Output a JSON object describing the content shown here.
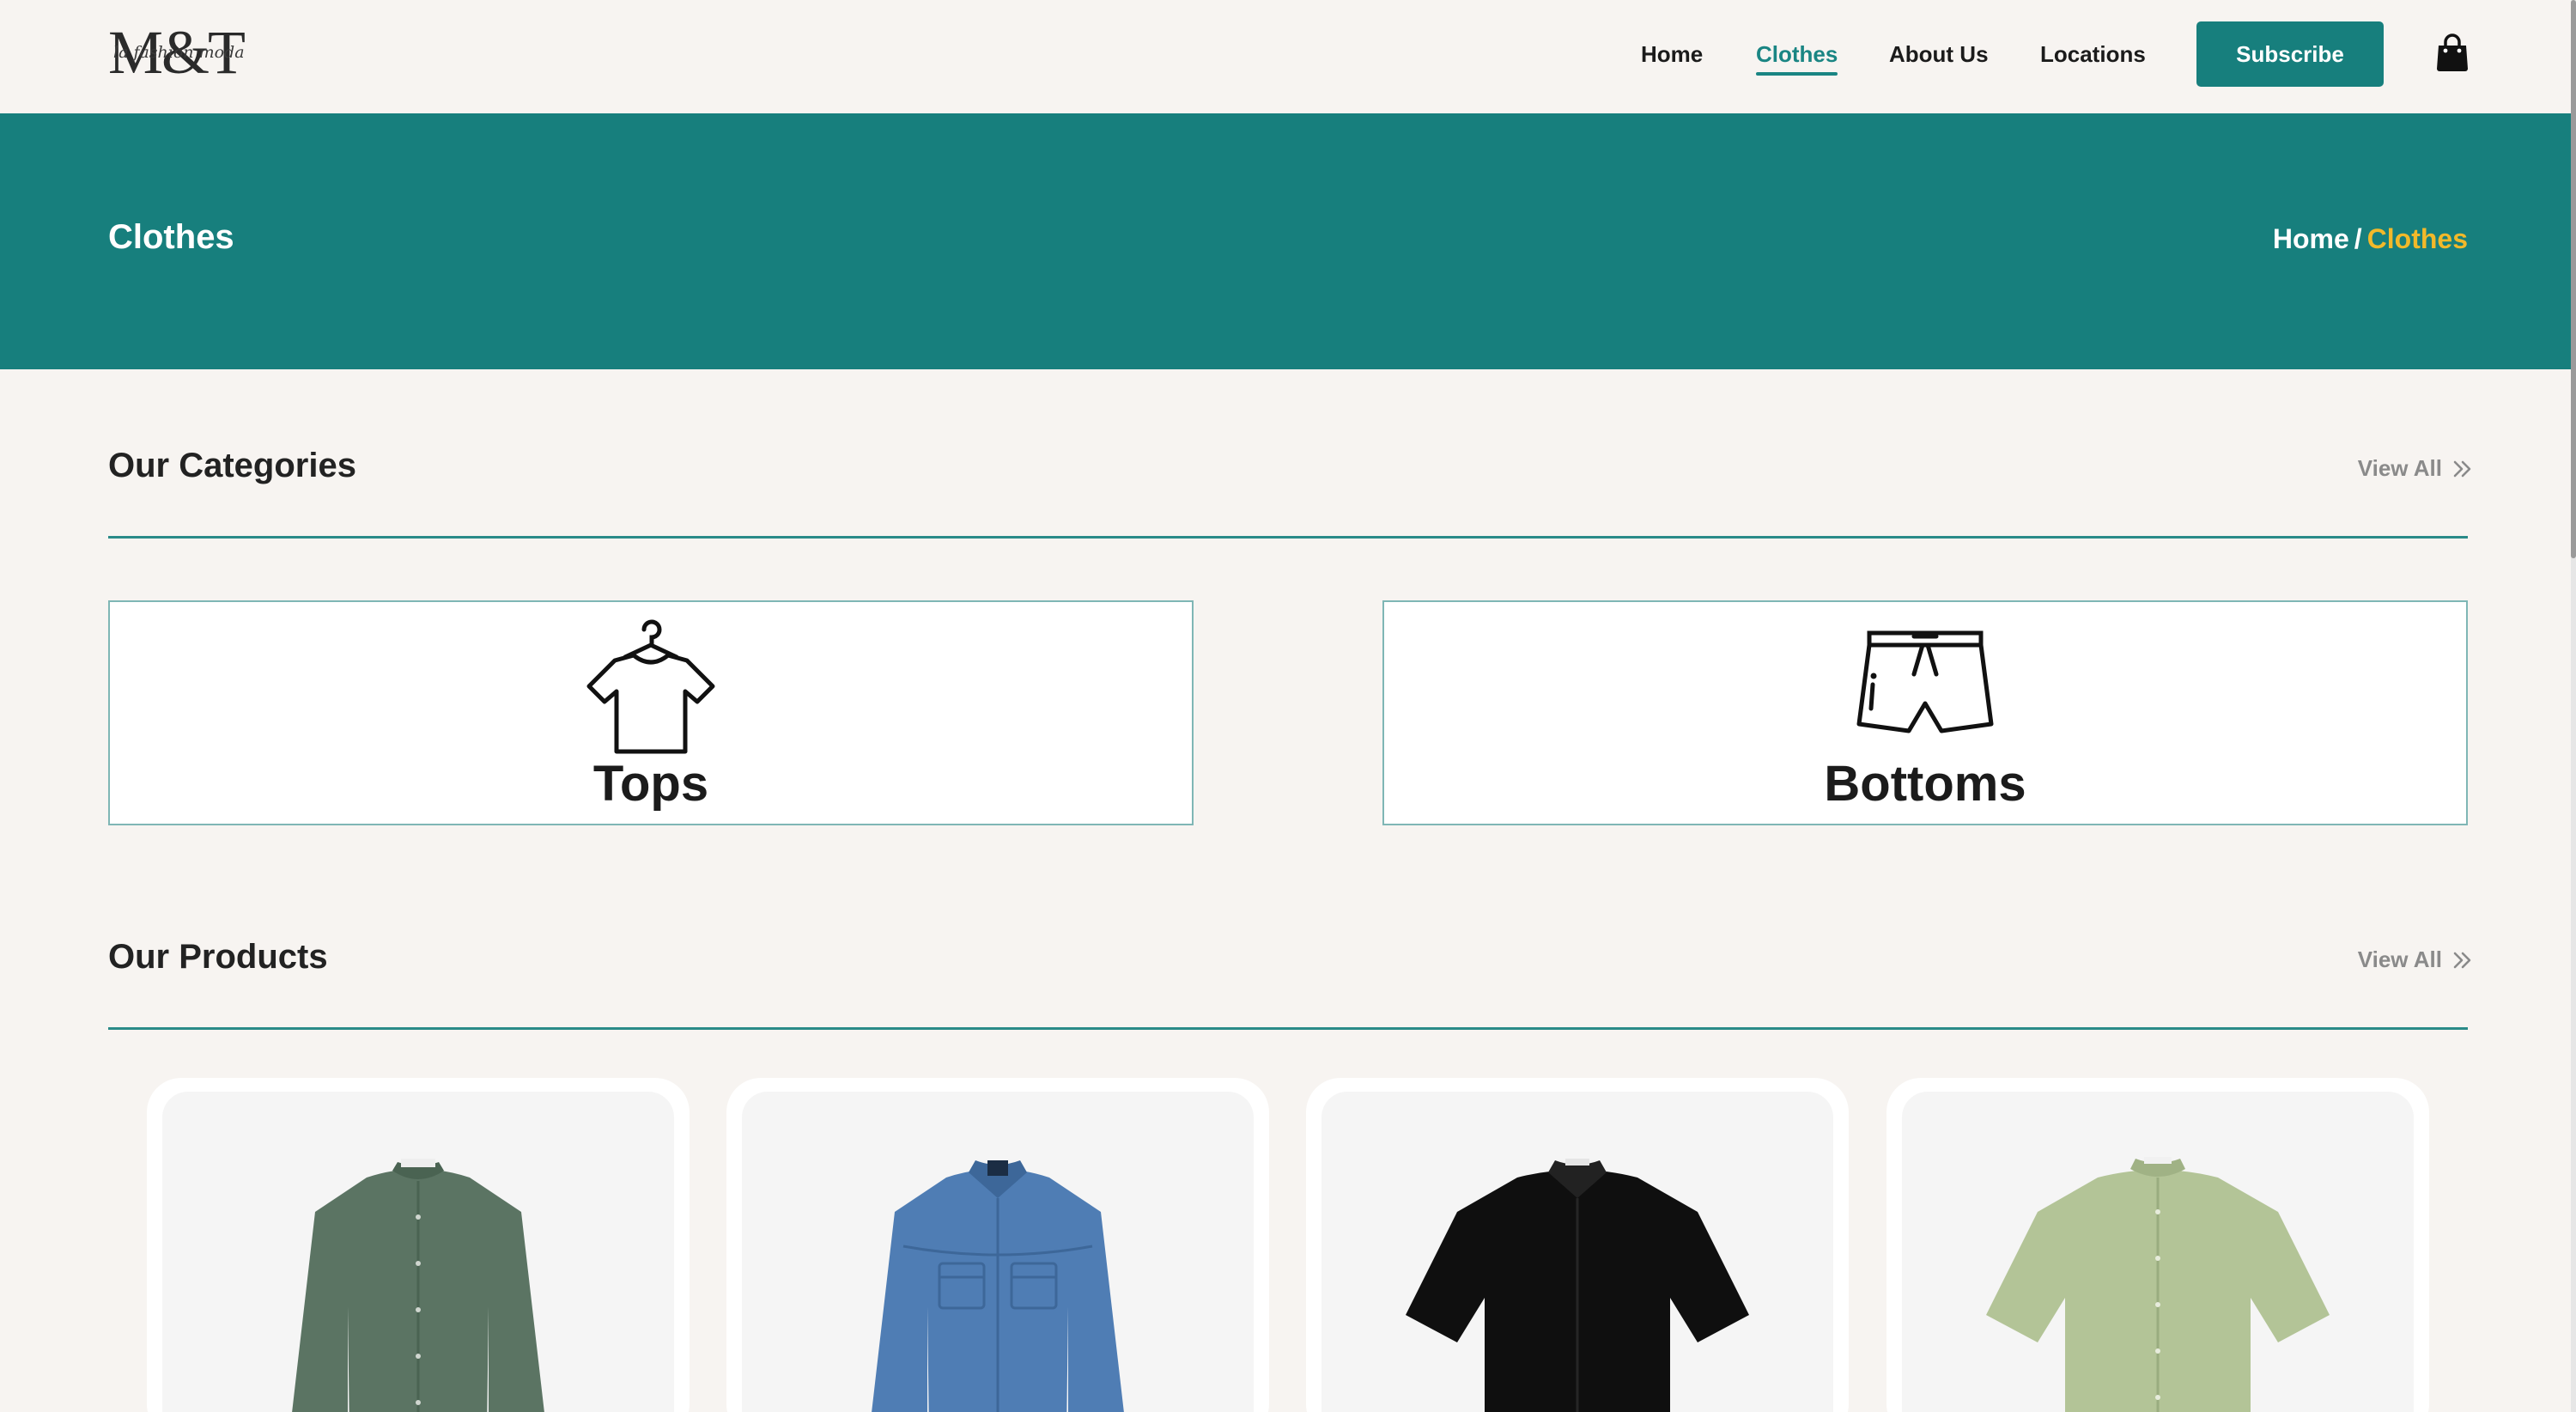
{
  "header": {
    "logo": {
      "mark": "M&T",
      "script": "la fashion moda"
    },
    "nav": [
      {
        "label": "Home",
        "active": false
      },
      {
        "label": "Clothes",
        "active": true
      },
      {
        "label": "About Us",
        "active": false
      },
      {
        "label": "Locations",
        "active": false
      }
    ],
    "subscribe_label": "Subscribe",
    "cart_icon": "shopping-bag-icon"
  },
  "banner": {
    "title": "Clothes",
    "breadcrumb": {
      "home": "Home",
      "separator": "/",
      "current": "Clothes"
    }
  },
  "categories_section": {
    "title": "Our Categories",
    "view_all": "View All",
    "items": [
      {
        "label": "Tops",
        "icon": "t-shirt-on-hanger-icon"
      },
      {
        "label": "Bottoms",
        "icon": "shorts-icon"
      }
    ]
  },
  "products_section": {
    "title": "Our Products",
    "view_all": "View All",
    "items": [
      {
        "image": "green-long-sleeve-shirt"
      },
      {
        "image": "blue-denim-shirt"
      },
      {
        "image": "black-short-sleeve-shirt"
      },
      {
        "image": "sage-short-sleeve-shirt"
      }
    ]
  },
  "colors": {
    "primary": "#177f7d",
    "accent": "#f2b92a",
    "background": "#f7f4f1"
  }
}
